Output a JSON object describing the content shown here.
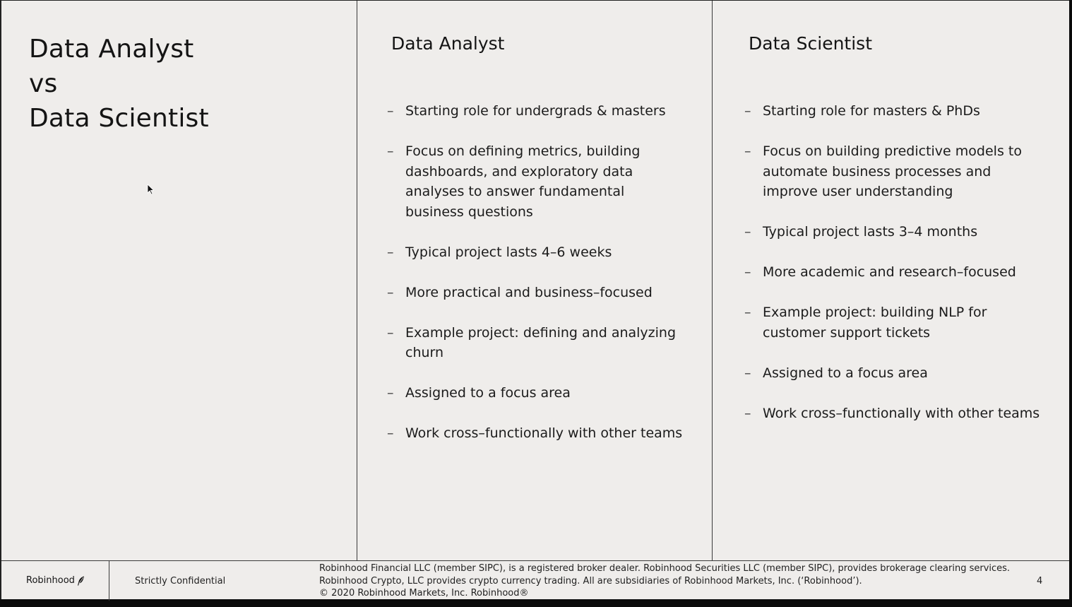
{
  "title": {
    "lines": [
      "Data Analyst",
      "vs",
      "Data Scientist"
    ]
  },
  "analyst": {
    "heading": "Data Analyst",
    "bullets": [
      "Starting role for undergrads & masters",
      "Focus on defining metrics, building dashboards, and exploratory data analyses to answer fundamental business questions",
      "Typical project lasts 4–6 weeks",
      "More practical and business–focused",
      "Example project: defining and analyzing churn",
      "Assigned to a focus area",
      "Work cross–functionally with other teams"
    ]
  },
  "scientist": {
    "heading": "Data Scientist",
    "bullets": [
      "Starting role for masters & PhDs",
      "Focus on building predictive models to automate business processes and improve user understanding",
      "Typical project lasts 3–4 months",
      "More academic and research–focused",
      "Example project: building NLP for customer support tickets",
      "Assigned to a focus area",
      "Work cross–functionally with other teams"
    ]
  },
  "footer": {
    "brand": "Robinhood",
    "brand_icon": "feather-icon",
    "confidential": "Strictly Confidential",
    "legal_line1": "Robinhood Financial LLC (member SIPC), is a registered broker dealer.  Robinhood Securities LLC (member SIPC), provides brokerage clearing services.",
    "legal_line2": "Robinhood Crypto, LLC provides crypto currency trading.  All are subsidiaries of Robinhood Markets, Inc. (‘Robinhood’).",
    "legal_line3": "© 2020 Robinhood Markets, Inc. Robinhood®",
    "page_number": "4"
  },
  "cursor_icon": "mouse-pointer-icon"
}
